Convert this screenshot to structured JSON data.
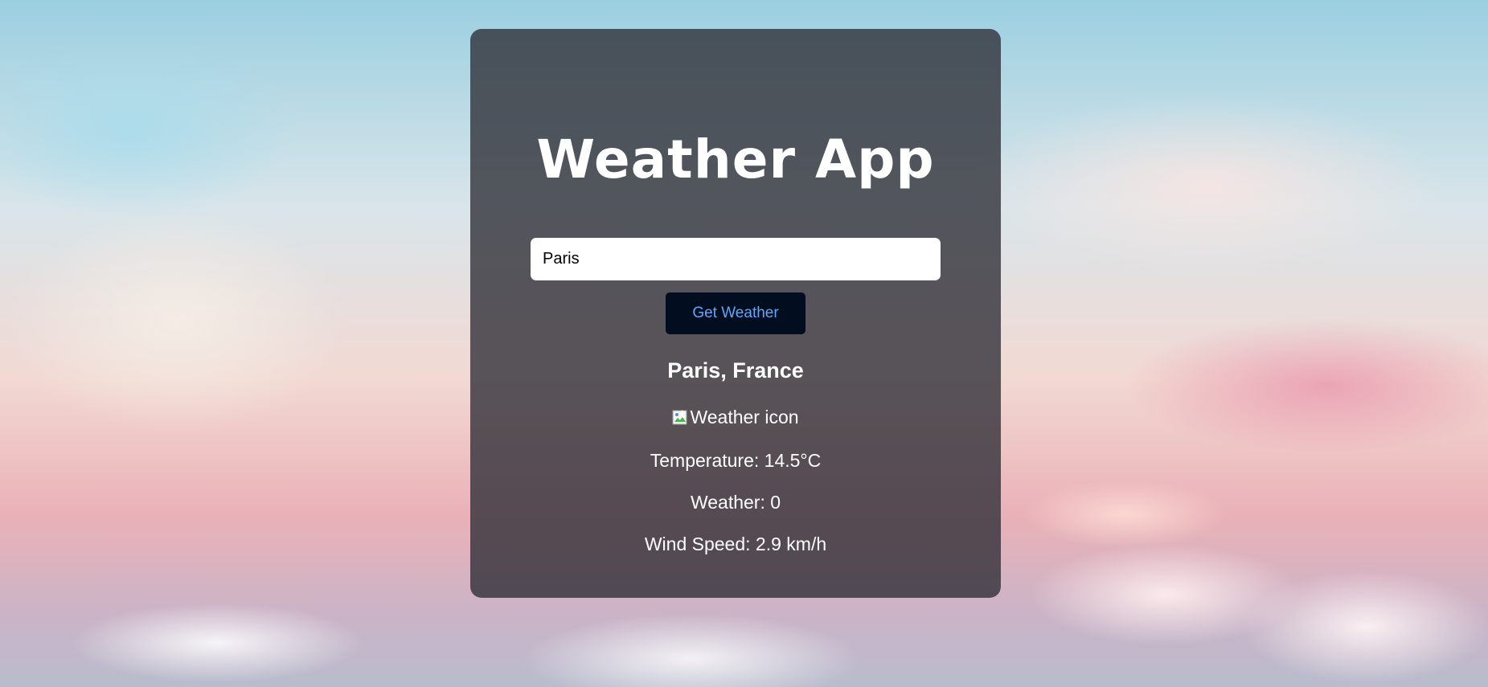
{
  "app": {
    "title": "Weather App"
  },
  "search": {
    "value": "Paris",
    "button_label": "Get Weather"
  },
  "result": {
    "location": "Paris, France",
    "icon_alt": "Weather icon",
    "temperature": "Temperature: 14.5°C",
    "weather": "Weather: 0",
    "wind_speed": "Wind Speed: 2.9 km/h"
  },
  "colors": {
    "card_background": "#2d2d34",
    "button_background": "#020d20",
    "button_text": "#5aa8ff"
  }
}
